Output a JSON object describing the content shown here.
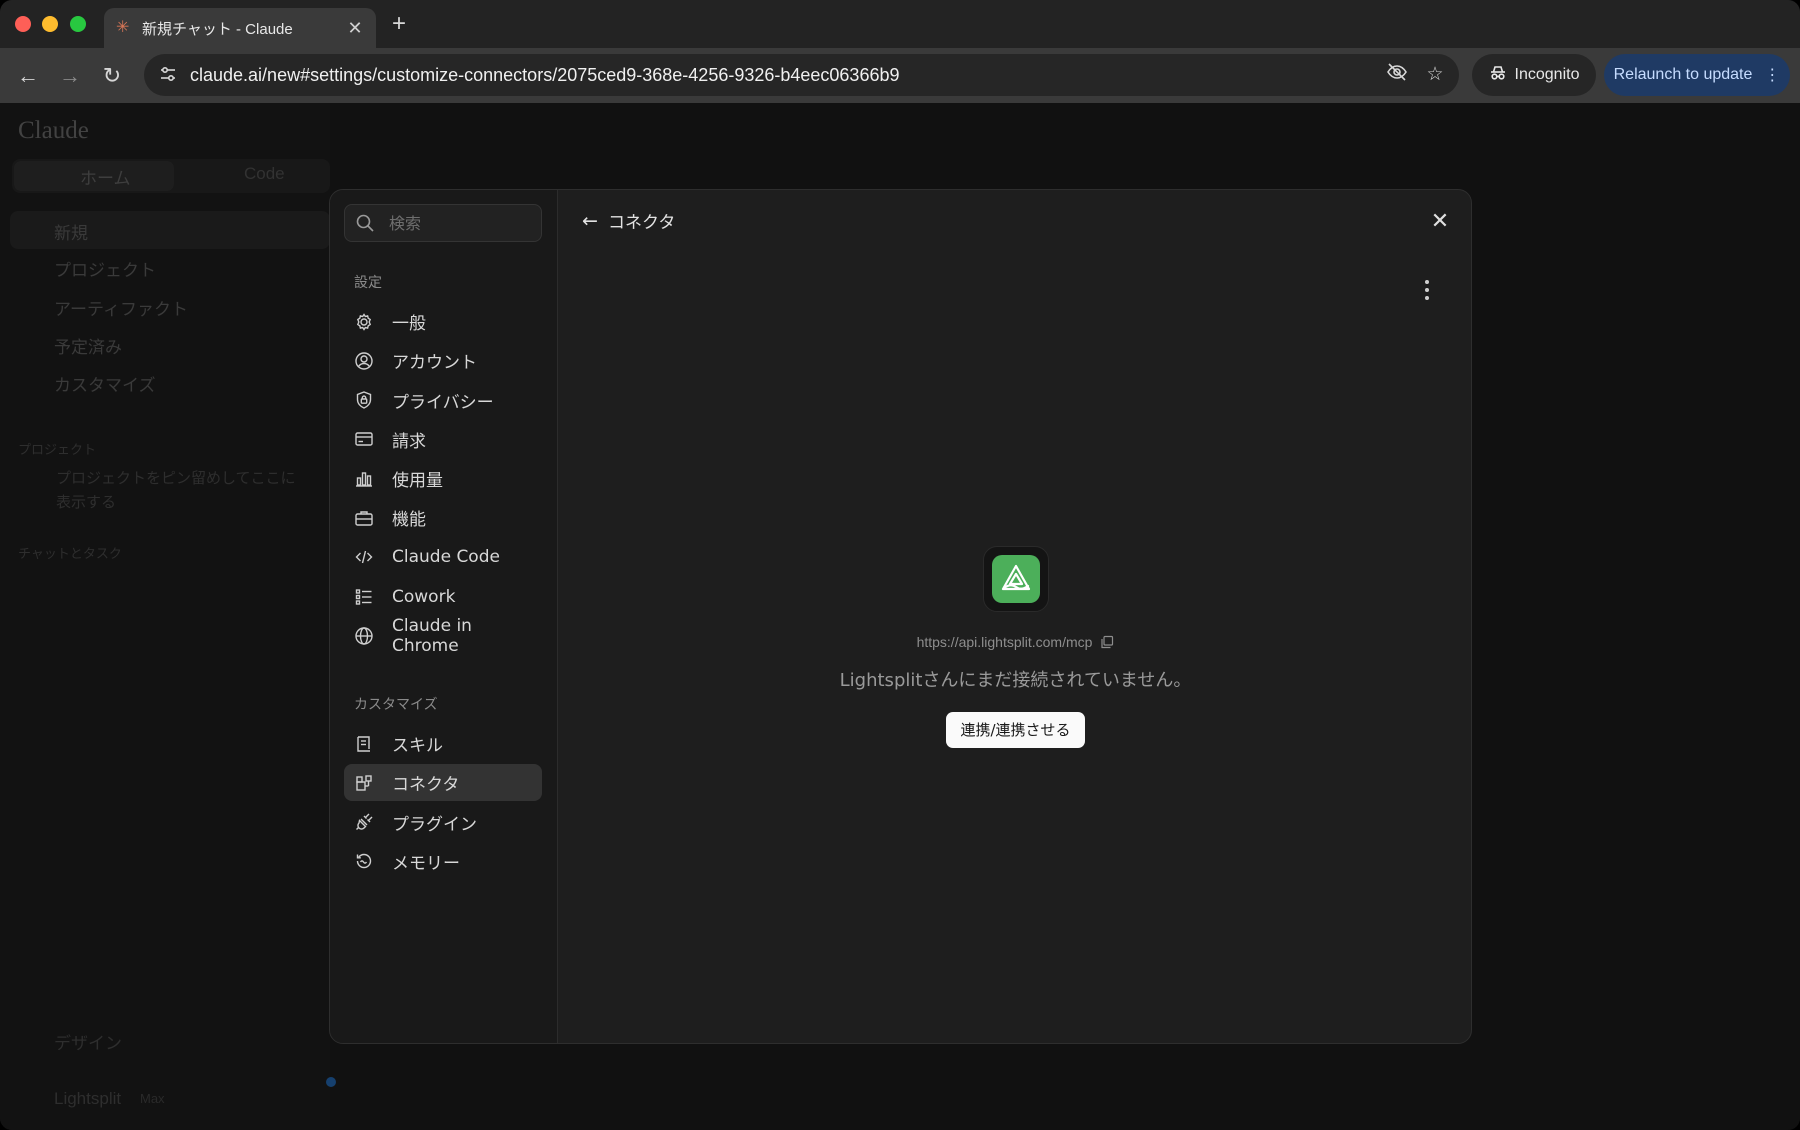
{
  "browser": {
    "tab_title": "新規チャット - Claude",
    "url": "claude.ai/new#settings/customize-connectors/2075ced9-368e-4256-9326-b4eec06366b9",
    "incognito_label": "Incognito",
    "relaunch_label": "Relaunch to update"
  },
  "background": {
    "logo": "Claude",
    "tabs": [
      "ホーム",
      "Code"
    ],
    "nav": [
      "新規",
      "プロジェクト",
      "アーティファクト",
      "予定済み",
      "カスタマイズ"
    ],
    "projects_header": "プロジェクト",
    "projects_hint_1": "プロジェクトをピン留めしてここに",
    "projects_hint_2": "表示する",
    "chats_header": "チャットとタスク",
    "design_item": "デザイン",
    "user_name": "Lightsplit",
    "user_plan": "Max"
  },
  "settings": {
    "search_placeholder": "検索",
    "section_settings": "設定",
    "settings_items": [
      {
        "label": "一般",
        "icon": "gear-icon"
      },
      {
        "label": "アカウント",
        "icon": "user-circle-icon"
      },
      {
        "label": "プライバシー",
        "icon": "shield-lock-icon"
      },
      {
        "label": "請求",
        "icon": "credit-card-icon"
      },
      {
        "label": "使用量",
        "icon": "bar-chart-icon"
      },
      {
        "label": "機能",
        "icon": "toolbox-icon"
      },
      {
        "label": "Claude Code",
        "icon": "code-icon"
      },
      {
        "label": "Cowork",
        "icon": "checklist-icon"
      },
      {
        "label": "Claude in Chrome",
        "icon": "globe-icon"
      }
    ],
    "section_customize": "カスタマイズ",
    "customize_items": [
      {
        "label": "スキル",
        "icon": "scroll-icon"
      },
      {
        "label": "コネクタ",
        "icon": "connector-icon",
        "active": true
      },
      {
        "label": "プラグイン",
        "icon": "plug-icon"
      },
      {
        "label": "メモリー",
        "icon": "memory-icon"
      }
    ]
  },
  "connector": {
    "back_label": "コネクタ",
    "server_url": "https://api.lightsplit.com/mcp",
    "notice": "Lightsplitさんにまだ接続されていません。",
    "connect_label": "連携/連携させる",
    "icon_color": "#4caf5a"
  }
}
